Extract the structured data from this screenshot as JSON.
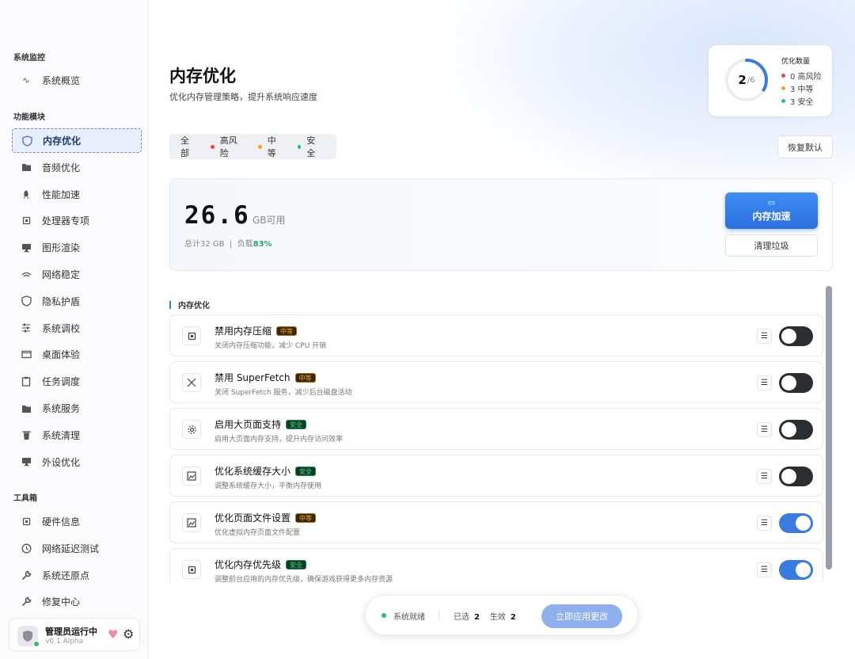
{
  "sidebar": {
    "sections": [
      "系统监控",
      "功能模块",
      "工具箱"
    ],
    "monitor_items": [
      {
        "label": "系统概览",
        "icon": "wave-icon"
      }
    ],
    "module_items": [
      {
        "label": "内存优化",
        "icon": "shield-icon",
        "active": true
      },
      {
        "label": "音频优化",
        "icon": "folder-icon"
      },
      {
        "label": "性能加速",
        "icon": "rocket-icon"
      },
      {
        "label": "处理器专项",
        "icon": "chip-icon"
      },
      {
        "label": "图形渲染",
        "icon": "monitor-icon"
      },
      {
        "label": "网络稳定",
        "icon": "wifi-icon"
      },
      {
        "label": "隐私护盾",
        "icon": "shield-icon"
      },
      {
        "label": "系统调校",
        "icon": "sliders-icon"
      },
      {
        "label": "桌面体验",
        "icon": "desktop-icon"
      },
      {
        "label": "任务调度",
        "icon": "clipboard-icon"
      },
      {
        "label": "系统服务",
        "icon": "folder-icon"
      },
      {
        "label": "系统清理",
        "icon": "trash-icon"
      },
      {
        "label": "外设优化",
        "icon": "monitor-icon"
      }
    ],
    "tool_items": [
      {
        "label": "硬件信息",
        "icon": "chip-icon"
      },
      {
        "label": "网络延迟测试",
        "icon": "clock-icon"
      },
      {
        "label": "系统还原点",
        "icon": "wrench-icon"
      },
      {
        "label": "修复中心",
        "icon": "wrench-icon"
      }
    ],
    "user": {
      "name": "管理员运行中",
      "version": "v0.1 Alpha"
    }
  },
  "page": {
    "title": "内存优化",
    "subtitle": "优化内存管理策略，提升系统响应速度"
  },
  "stats": {
    "title": "优化数量",
    "current": "2",
    "total": "/6",
    "progress": 0.333,
    "rows": [
      {
        "label": "0 高风险",
        "color": "#e5484d"
      },
      {
        "label": "3 中等",
        "color": "#f0a52a"
      },
      {
        "label": "3 安全",
        "color": "#2fbf71"
      }
    ]
  },
  "filters": [
    {
      "label": "全部",
      "color": ""
    },
    {
      "label": "高风险",
      "color": "#e5484d"
    },
    {
      "label": "中等",
      "color": "#f0a52a"
    },
    {
      "label": "安全",
      "color": "#2fbf71"
    }
  ],
  "restore_label": "恢复默认",
  "memory": {
    "value": "26.6",
    "unit": "GB可用",
    "total_label": "总计32 GB",
    "sep": "|",
    "load_label": "负载",
    "load_value": "83%",
    "boost_label": "内存加速",
    "clean_label": "清理垃圾"
  },
  "list_title": "内存优化",
  "items": [
    {
      "name": "禁用内存压缩",
      "badge": "中等",
      "level": "mid",
      "desc": "关闭内存压缩功能，减少 CPU 开销",
      "icon": "chip-icon",
      "on": false
    },
    {
      "name": "禁用 SuperFetch",
      "badge": "中等",
      "level": "mid",
      "desc": "关闭 SuperFetch 服务，减少后台磁盘活动",
      "icon": "close-icon",
      "on": false
    },
    {
      "name": "启用大页面支持",
      "badge": "安全",
      "level": "safe",
      "desc": "启用大页面内存支持，提升内存访问效率",
      "icon": "gear-icon",
      "on": false
    },
    {
      "name": "优化系统缓存大小",
      "badge": "安全",
      "level": "safe",
      "desc": "调整系统缓存大小，平衡内存使用",
      "icon": "image-icon",
      "on": false
    },
    {
      "name": "优化页面文件设置",
      "badge": "中等",
      "level": "mid",
      "desc": "优化虚拟内存页面文件配置",
      "icon": "image-icon",
      "on": true
    },
    {
      "name": "优化内存优先级",
      "badge": "安全",
      "level": "safe",
      "desc": "调整前台应用的内存优先级，确保游戏获得更多内存资源",
      "icon": "chip-icon",
      "on": true
    }
  ],
  "footer": {
    "status": "系统就绪",
    "selected_label": "已选",
    "selected_value": "2",
    "active_label": "生效",
    "active_value": "2",
    "apply_label": "立即应用更改"
  },
  "colors": {
    "accent": "#3b7be0",
    "success": "#2fbf71",
    "warning": "#f0a52a",
    "danger": "#e5484d"
  }
}
